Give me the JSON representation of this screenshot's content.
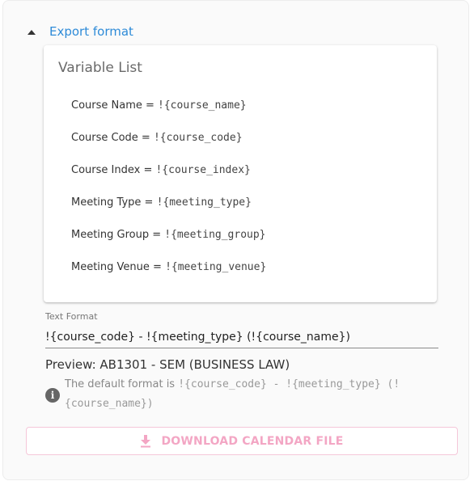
{
  "export_section": {
    "toggle_label": "Export format",
    "expanded": true
  },
  "variable_list": {
    "title": "Variable List",
    "items": [
      {
        "label": "Course Name = ",
        "code": "!{course_name}"
      },
      {
        "label": "Course Code = ",
        "code": "!{course_code}"
      },
      {
        "label": "Course Index = ",
        "code": "!{course_index}"
      },
      {
        "label": "Meeting Type = ",
        "code": "!{meeting_type}"
      },
      {
        "label": "Meeting Group = ",
        "code": "!{meeting_group}"
      },
      {
        "label": "Meeting Venue = ",
        "code": "!{meeting_venue}"
      }
    ]
  },
  "text_format": {
    "label": "Text Format",
    "value": "!{course_code} - !{meeting_type} (!{course_name})"
  },
  "preview": {
    "text": "Preview: AB1301 - SEM (BUSINESS LAW)"
  },
  "hint": {
    "prefix": "The default format is ",
    "code": "!{course_code} - !{meeting_type} (!{course_name})"
  },
  "download": {
    "label": "DOWNLOAD CALENDAR FILE"
  },
  "colors": {
    "accent": "#2e8bd8",
    "button_text": "#f3a6c4",
    "button_border": "#f5c7d9"
  },
  "icons": {
    "toggle": "caret-up-icon",
    "info": "info-icon",
    "download": "download-icon"
  }
}
